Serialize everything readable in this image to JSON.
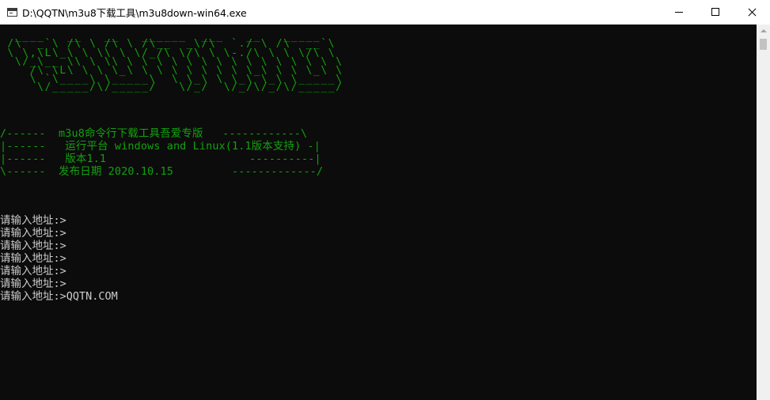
{
  "window": {
    "title": "D:\\QQTN\\m3u8下载工具\\m3u8down-win64.exe"
  },
  "console": {
    "ascii_art": [
      "  ____   __   __   ______  ___   __   _____ ",
      " /\\  _`\\ /\\ \\ /\\ \\ /\\__  _\\/\\  `./ \\ /\\  __`\\",
      " \\ \\,\\L\\_\\ \\ \\\\ \\ \\/_/\\ \\/\\ \\ \\-./\\ \\ \\ \\/\\ \\",
      "  \\/_\\__ \\\\ \\ \\\\ \\ \\ \\ \\ \\ \\ \\ \\ \\ \\ \\ \\ \\ \\ \\",
      "    /\\ \\L\\ \\ \\ \\_\\ \\ \\ \\ \\ \\ \\ \\ \\_\\ \\ \\ \\_\\ \\",
      "    \\ `\\____\\ \\_____\\  \\ \\_\\ \\ \\_\\ \\_\\ \\_____\\",
      "     \\/_____/\\/_____/   \\/_/  \\/_/\\/_/\\/_____/"
    ],
    "banner": [
      "/------  m3u8命令行下载工具吾爱专版   ------------\\",
      "|------   运行平台 windows and Linux(1.1版本支持) -|",
      "|------   版本1.1                      ----------|",
      "\\------  发布日期 2020.10.15         -------------/"
    ],
    "prompts": [
      "请输入地址:>",
      "请输入地址:>",
      "请输入地址:>",
      "请输入地址:>",
      "请输入地址:>",
      "请输入地址:>",
      "请输入地址:>QQTN.COM"
    ],
    "colors": {
      "background": "#0c0c0c",
      "green": "#13a10e",
      "text": "#cccccc"
    }
  }
}
